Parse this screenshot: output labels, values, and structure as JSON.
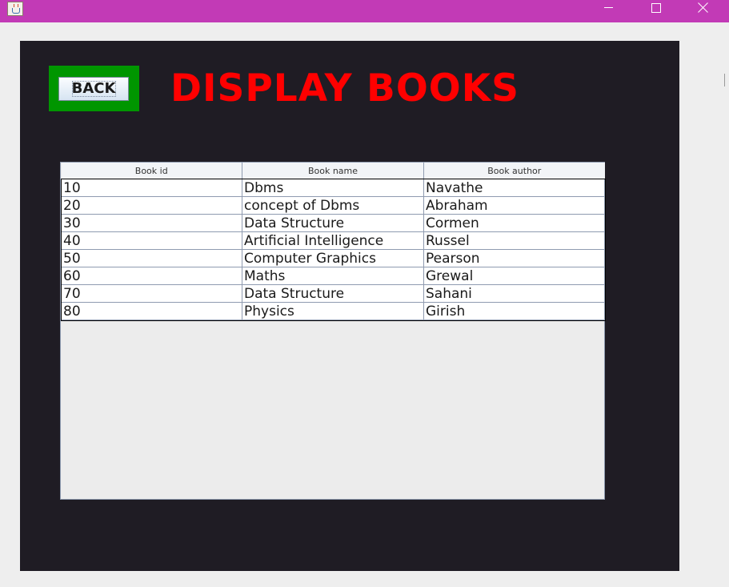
{
  "window": {
    "app_icon": "java-cup-icon",
    "controls": [
      "minimize-icon",
      "maximize-icon",
      "close-icon"
    ],
    "colors": {
      "titlebar": "#c23ab6",
      "panel": "#1f1c24",
      "back_frame": "#009600",
      "title_text": "#ff0000"
    }
  },
  "header": {
    "back_label": "BACK",
    "title": "DISPLAY BOOKS"
  },
  "table": {
    "columns": [
      "Book id",
      "Book name",
      "Book author"
    ],
    "rows": [
      [
        "10",
        "Dbms",
        "Navathe"
      ],
      [
        "20",
        "concept of Dbms",
        "Abraham"
      ],
      [
        "30",
        "Data Structure",
        "Cormen"
      ],
      [
        "40",
        "Artificial Intelligence",
        "Russel"
      ],
      [
        "50",
        "Computer Graphics",
        "Pearson"
      ],
      [
        "60",
        "Maths",
        "Grewal"
      ],
      [
        "70",
        "Data Structure",
        "Sahani"
      ],
      [
        "80",
        "Physics",
        "Girish"
      ]
    ]
  }
}
